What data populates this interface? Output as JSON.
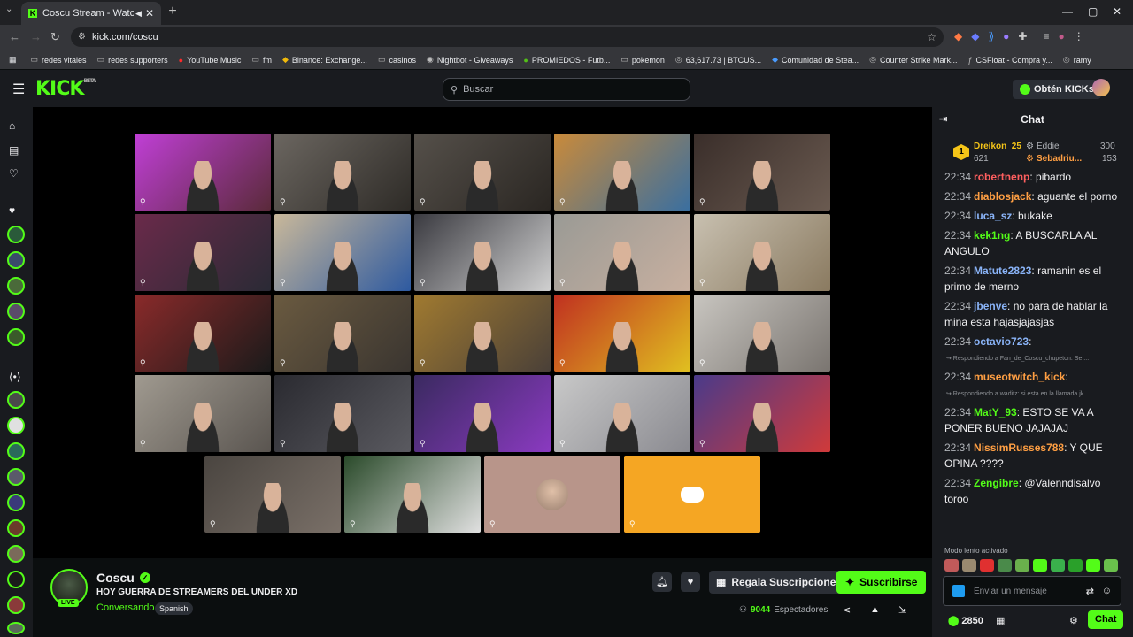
{
  "browser": {
    "tab_title": "Coscu Stream - Watch Live",
    "url": "kick.com/coscu",
    "bookmarks": [
      "redes vitales",
      "redes supporters",
      "YouTube Music",
      "fm",
      "Binance: Exchange...",
      "casinos",
      "Nightbot - Giveaways",
      "PROMIEDOS - Futb...",
      "pokemon",
      "63,617.73 | BTCUS...",
      "Comunidad de Stea...",
      "Counter Strike Mark...",
      "CSFloat - Compra y...",
      "ramy"
    ]
  },
  "header": {
    "logo": "KICK",
    "logo_badge": "BETA",
    "search_placeholder": "Buscar",
    "kicks_button": "Obtén KICKs"
  },
  "stream": {
    "streamer_name": "Coscu",
    "title": "HOY GUERRA DE STREAMERS DEL UNDER XD",
    "category": "Conversando",
    "language_tag": "Spanish",
    "live_label": "LIVE",
    "gift_button": "Regala Suscripciones",
    "subscribe_button": "Suscribirse",
    "viewer_count": "9044",
    "viewer_label": "Espectadores"
  },
  "video_tiles": [
    {
      "colors": [
        "#c03fd6",
        "#5a2a3a"
      ]
    },
    {
      "colors": [
        "#6b6660",
        "#2e2b27"
      ]
    },
    {
      "colors": [
        "#55504a",
        "#2a2622"
      ]
    },
    {
      "colors": [
        "#c98a3a",
        "#3a6fa0"
      ]
    },
    {
      "colors": [
        "#3a2e2a",
        "#6a5a50"
      ]
    },
    {
      "colors": [
        "#6a2a4a",
        "#2a2a35"
      ]
    },
    {
      "colors": [
        "#c9b89a",
        "#2e5aa0"
      ]
    },
    {
      "colors": [
        "#3a3a40",
        "#d0d0d0"
      ]
    },
    {
      "colors": [
        "#9a9a95",
        "#c8b0a0"
      ]
    },
    {
      "colors": [
        "#c8c0b0",
        "#8a7a60"
      ]
    },
    {
      "colors": [
        "#8a2a2a",
        "#1a1a1a"
      ]
    },
    {
      "colors": [
        "#6a5a40",
        "#3a3530"
      ]
    },
    {
      "colors": [
        "#a07a30",
        "#4a4038"
      ]
    },
    {
      "colors": [
        "#c03020",
        "#e0c020"
      ]
    },
    {
      "colors": [
        "#c8c5c0",
        "#7a7570"
      ]
    },
    {
      "colors": [
        "#a09a90",
        "#5a5550"
      ]
    },
    {
      "colors": [
        "#2a2a30",
        "#5a5a60"
      ]
    },
    {
      "colors": [
        "#3a2a60",
        "#8a3ac0"
      ]
    },
    {
      "colors": [
        "#c8c8c8",
        "#8a8a90"
      ]
    },
    {
      "colors": [
        "#4a3a8a",
        "#d03a3a"
      ]
    },
    {
      "colors": [
        "#4a4540",
        "#7a7068"
      ]
    },
    {
      "colors": [
        "#2a4a2a",
        "#e0e0e0"
      ]
    },
    {
      "colors": [
        "#b8958a",
        "#b8958a"
      ]
    },
    {
      "colors": [
        "#f5a623",
        "#f5a623"
      ]
    }
  ],
  "chat": {
    "title": "Chat",
    "pinned": [
      {
        "name": "Dreikon_25",
        "value": "621",
        "rank": "1"
      },
      {
        "name": "Eddie",
        "value": "300"
      },
      {
        "name": "Sebadriu...",
        "value": "153"
      }
    ],
    "messages": [
      {
        "time": "22:34",
        "user": "robertnenp",
        "text": ": pibardo",
        "color": "#ff5f5f"
      },
      {
        "time": "22:34",
        "user": "diablosjack",
        "text": ": aguante el porno",
        "color": "#ff9f43"
      },
      {
        "time": "22:34",
        "user": "luca_sz",
        "text": ": bukake",
        "color": "#8ab4f8"
      },
      {
        "time": "22:34",
        "user": "kek1ng",
        "text": ": A BUSCARLA AL ANGULO",
        "color": "#53fc18"
      },
      {
        "time": "22:34",
        "user": "Matute2823",
        "text": ": ramanin es el primo de merno",
        "color": "#8ab4f8"
      },
      {
        "time": "22:34",
        "user": "jbenve",
        "text": ": no para de hablar la mina esta hajasjajasjas",
        "color": "#8ab4f8"
      },
      {
        "time": "22:34",
        "user": "octavio723",
        "text": ":",
        "color": "#8ab4f8"
      },
      {
        "reply": "Respondiendo a Fan_de_Coscu_chupeton: Se ..."
      },
      {
        "time": "22:34",
        "user": "museotwitch_kick",
        "text": ":",
        "color": "#ff9f43"
      },
      {
        "reply": "Respondiendo a waditz: si esta en la llamada jk..."
      },
      {
        "time": "22:34",
        "user": "MatY_93",
        "text": ": ESTO SE VA A PONER BUENO JAJAJAJ",
        "color": "#53fc18"
      },
      {
        "time": "22:34",
        "user": "NissimRusses788",
        "text": ": Y QUE OPINA ????",
        "color": "#ff9f43"
      },
      {
        "time": "22:34",
        "user": "Zengibre",
        "text": ": @Valenndisalvo toroo",
        "color": "#53fc18"
      }
    ],
    "slow_mode": "Modo lento activado",
    "input_placeholder": "Enviar un mensaje",
    "kicks_balance": "2850",
    "send_button": "Chat"
  }
}
